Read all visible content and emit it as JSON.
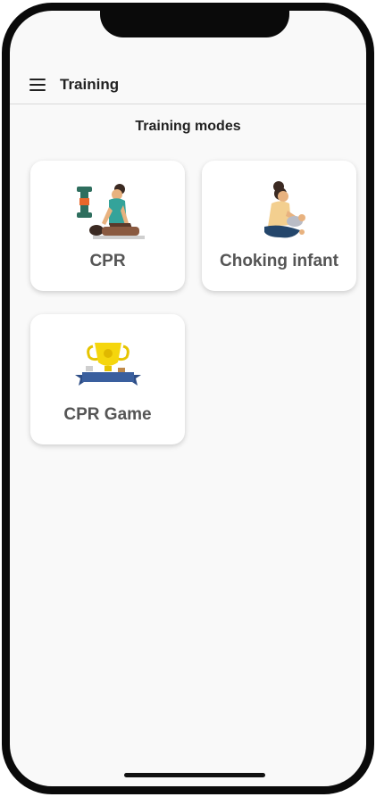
{
  "header": {
    "title": "Training",
    "menu_icon": "hamburger-menu-icon"
  },
  "section": {
    "title": "Training modes"
  },
  "modes": [
    {
      "label": "CPR",
      "icon": "cpr-training-illustration"
    },
    {
      "label": "Choking infant",
      "icon": "choking-infant-illustration"
    },
    {
      "label": "CPR Game",
      "icon": "trophy-game-illustration"
    }
  ],
  "colors": {
    "background": "#f9f9f9",
    "card": "#ffffff",
    "text_primary": "#222222",
    "text_card": "#555555",
    "frame": "#0a0a0a"
  }
}
